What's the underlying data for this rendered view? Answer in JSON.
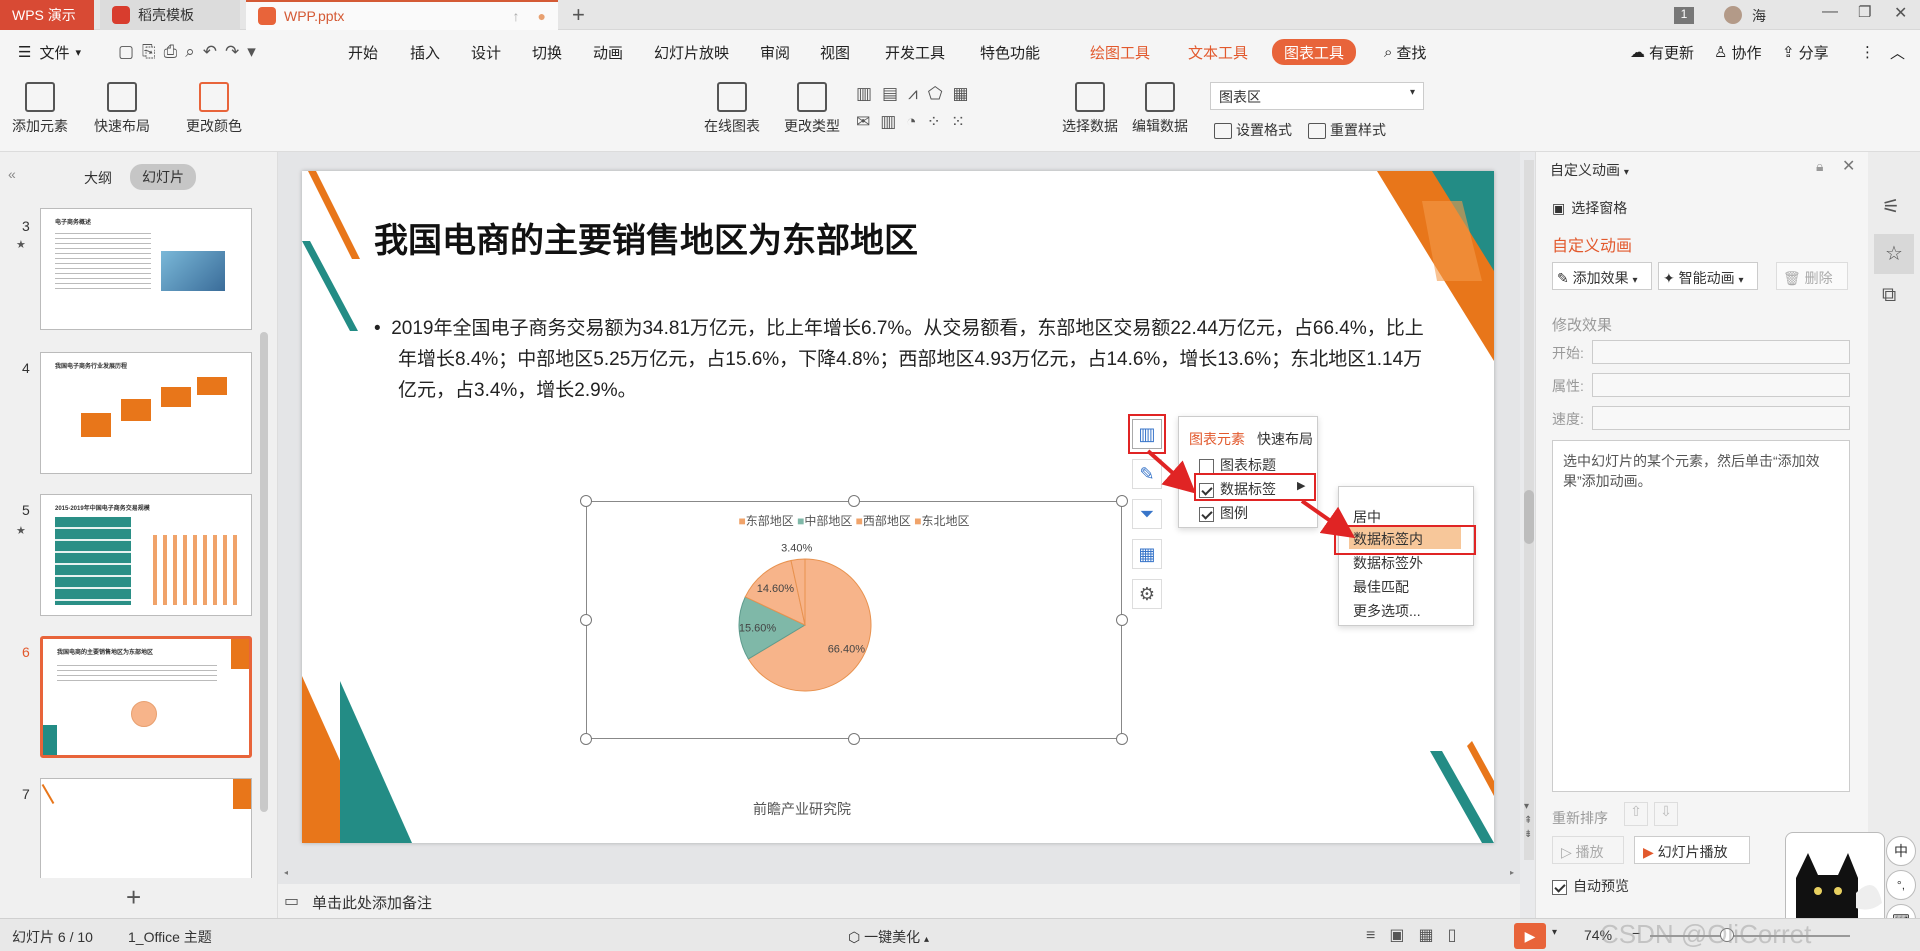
{
  "titlebar": {
    "tabs": [
      {
        "label": "WPS 演示"
      },
      {
        "label": "稻壳模板"
      },
      {
        "label": "WPP.pptx"
      }
    ],
    "badge": "1",
    "user": "海"
  },
  "menubar": {
    "file": "文件",
    "items": [
      "开始",
      "插入",
      "设计",
      "切换",
      "动画",
      "幻灯片放映",
      "审阅",
      "视图",
      "开发工具",
      "特色功能"
    ],
    "context_tabs": [
      "绘图工具",
      "文本工具",
      "图表工具"
    ],
    "search": "查找",
    "right": [
      "有更新",
      "协作",
      "分享"
    ]
  },
  "toolbar": {
    "add_element": "添加元素",
    "quick_layout": "快速布局",
    "change_color": "更改颜色",
    "online_chart": "在线图表",
    "change_type": "更改类型",
    "select_data": "选择数据",
    "edit_data": "编辑数据",
    "chart_area_select": "图表区",
    "set_format": "设置格式",
    "reset_style": "重置样式"
  },
  "leftpanel": {
    "tab_outline": "大纲",
    "tab_slides": "幻灯片",
    "slides": [
      {
        "num": "3",
        "title": "电子商务概述"
      },
      {
        "num": "4",
        "title": "我国电子商务行业发展历程"
      },
      {
        "num": "5",
        "title": "2015-2019年中国电子商务交易规模"
      },
      {
        "num": "6",
        "title": "我国电商的主要销售地区为东部地区"
      },
      {
        "num": "7",
        "title": ""
      }
    ]
  },
  "slide": {
    "title": "我国电商的主要销售地区为东部地区",
    "bullet": "2019年全国电子商务交易额为34.81万亿元，比上年增长6.7%。从交易额看，东部地区交易额22.44万亿元，占66.4%，比上年增长8.4%；中部地区5.25万亿元，占15.6%，下降4.8%；西部地区4.93万亿元，占14.6%，增长13.6%；东北地区1.14万亿元，占3.4%，增长2.9%。",
    "source": "前瞻产业研究院"
  },
  "chart_data": {
    "type": "pie",
    "categories": [
      "东部地区",
      "中部地区",
      "西部地区",
      "东北地区"
    ],
    "values": [
      66.4,
      15.6,
      14.6,
      3.4
    ],
    "labels": [
      "66.40%",
      "15.60%",
      "14.60%",
      "3.40%"
    ],
    "colors": [
      "#f7b48a",
      "#7fb8a8",
      "#f7b48a",
      "#f7b48a"
    ],
    "legend_position": "top"
  },
  "chart_popup": {
    "tab_elements": "图表元素",
    "tab_quick_layout": "快速布局",
    "options": [
      {
        "label": "图表标题",
        "checked": false
      },
      {
        "label": "数据标签",
        "checked": true
      },
      {
        "label": "图例",
        "checked": true
      }
    ],
    "submenu": [
      "居中",
      "数据标签内",
      "数据标签外",
      "最佳匹配",
      "更多选项..."
    ]
  },
  "note_placeholder": "单击此处添加备注",
  "rightpanel": {
    "header": "自定义动画",
    "select_pane": "选择窗格",
    "section_title": "自定义动画",
    "add_effect": "添加效果",
    "smart_anim": "智能动画",
    "delete": "删除",
    "modify_effect": "修改效果",
    "start_label": "开始:",
    "property_label": "属性:",
    "speed_label": "速度:",
    "hint": "选中幻灯片的某个元素，然后单击“添加效果”添加动画。",
    "reorder": "重新排序",
    "play": "播放",
    "slideshow": "幻灯片播放",
    "auto_preview": "自动预览"
  },
  "statusbar": {
    "slide_pos": "幻灯片 6 / 10",
    "theme": "1_Office 主题",
    "beautify": "一键美化",
    "zoom": "74%",
    "watermark": "CSDN @OliCorret"
  }
}
